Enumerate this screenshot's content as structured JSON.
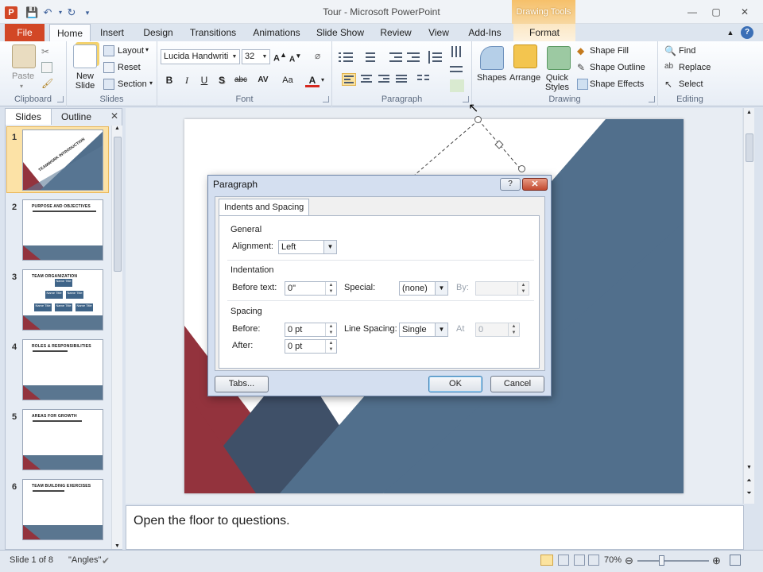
{
  "window": {
    "title": "Tour  -  Microsoft PowerPoint",
    "app_icon": "P",
    "context_tab_header": "Drawing Tools",
    "controls": {
      "minimize": "—",
      "maximize": "▢",
      "close": "✕"
    }
  },
  "tabs": {
    "file": "File",
    "items": [
      "Home",
      "Insert",
      "Design",
      "Transitions",
      "Animations",
      "Slide Show",
      "Review",
      "View",
      "Add-Ins",
      "Format"
    ],
    "active": "Home"
  },
  "ribbon": {
    "clipboard": {
      "label": "Clipboard",
      "paste": "Paste"
    },
    "slides": {
      "label": "Slides",
      "new_slide": "New\nSlide",
      "layout": "Layout",
      "reset": "Reset",
      "section": "Section"
    },
    "font": {
      "label": "Font",
      "font_name": "Lucida Handwriti",
      "font_size": "32",
      "bold": "B",
      "italic": "I",
      "underline": "U",
      "strike": "S",
      "shadow": "abc",
      "spacing": "AV",
      "case": "Aa",
      "color": "A"
    },
    "paragraph": {
      "label": "Paragraph"
    },
    "drawing": {
      "label": "Drawing",
      "shapes": "Shapes",
      "arrange": "Arrange",
      "quick_styles": "Quick\nStyles",
      "shape_fill": "Shape Fill",
      "shape_outline": "Shape Outline",
      "shape_effects": "Shape Effects"
    },
    "editing": {
      "label": "Editing",
      "find": "Find",
      "replace": "Replace",
      "select": "Select"
    }
  },
  "slides_panel": {
    "tab_slides": "Slides",
    "tab_outline": "Outline",
    "thumbnails": [
      {
        "num": "1",
        "title": "TEAMWORK INTRODUCTION"
      },
      {
        "num": "2",
        "title": "PURPOSE AND OBJECTIVES"
      },
      {
        "num": "3",
        "title": "TEAM ORGANIZATION"
      },
      {
        "num": "4",
        "title": "ROLES & RESPONSIBILITIES"
      },
      {
        "num": "5",
        "title": "AREAS FOR GROWTH"
      },
      {
        "num": "6",
        "title": "TEAM BUILDING EXERCISES"
      }
    ],
    "org_boxes": [
      "Name Title",
      "Name Title",
      "Name Title",
      "Name Title",
      "Name Title",
      "Name Title"
    ]
  },
  "notes": "Open the floor to questions.",
  "status": {
    "slide": "Slide 1 of 8",
    "theme": "\"Angles\"",
    "zoom": "70%"
  },
  "dialog": {
    "title": "Paragraph",
    "help": "?",
    "close": "✕",
    "tab": "Indents and Spacing",
    "general": {
      "heading": "General",
      "alignment_label": "Alignment:",
      "alignment_value": "Left"
    },
    "indentation": {
      "heading": "Indentation",
      "before_text_label": "Before text:",
      "before_text_value": "0\"",
      "special_label": "Special:",
      "special_value": "(none)",
      "by_label": "By:",
      "by_value": ""
    },
    "spacing": {
      "heading": "Spacing",
      "before_label": "Before:",
      "before_value": "0 pt",
      "after_label": "After:",
      "after_value": "0 pt",
      "line_spacing_label": "Line Spacing:",
      "line_spacing_value": "Single",
      "at_label": "At",
      "at_value": "0"
    },
    "tabs_button": "Tabs...",
    "ok": "OK",
    "cancel": "Cancel"
  },
  "colors": {
    "file_tab": "#d24726",
    "slide_blue": "#516f8c",
    "slide_dark": "#3f5068",
    "slide_red": "#93333d",
    "dialog_frame": "#d4dff0"
  }
}
